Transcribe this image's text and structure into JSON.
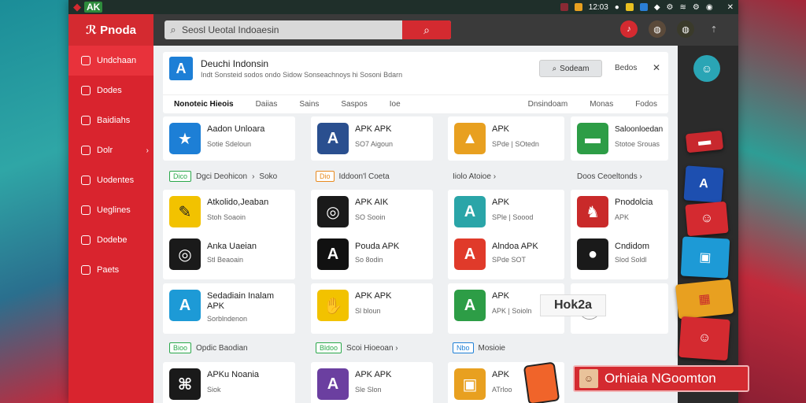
{
  "topbar": {
    "brand": "AK",
    "time": "12:03",
    "tray_colors": [
      "#d42a30",
      "#e8a020",
      "#2a7fd6",
      "#ffffff"
    ]
  },
  "header": {
    "logo": "Pnoda",
    "search_text": "Seosl Ueotal Indoaesin",
    "search_button_icon": "search-icon"
  },
  "sidebar": {
    "items": [
      {
        "label": "Undchaan",
        "icon": "home-icon"
      },
      {
        "label": "Dodes",
        "icon": "grid-icon"
      },
      {
        "label": "Baidiahs",
        "icon": "list-icon"
      },
      {
        "label": "Dolr",
        "icon": "folder-icon"
      },
      {
        "label": "Uodentes",
        "icon": "update-icon"
      },
      {
        "label": "Ueglines",
        "icon": "star-icon"
      },
      {
        "label": "Dodebe",
        "icon": "user-icon"
      },
      {
        "label": "Paets",
        "icon": "gift-icon"
      }
    ]
  },
  "apphead": {
    "icon_letter": "A",
    "title": "Deuchi Indonsin",
    "subtitle": "Indt Sonsteid sodos ondo Sidow Sonseachnoys hi Sosoni Bdarn",
    "search_box": "Sodeam",
    "extra": "Bedos",
    "tabs": [
      "Nonoteic Hieois",
      "Daiias",
      "Sains",
      "Saspos",
      "Ioe",
      "Dnsindoam",
      "Monas",
      "Fodos"
    ]
  },
  "cards": [
    {
      "name": "Aadon Unloara",
      "desc": "Sotie Sdeloun",
      "icon_color": "#1d7fd6",
      "icon_letter": "★"
    },
    {
      "name": "APK APK",
      "desc": "SO7 Aigoun",
      "icon_color": "#2a4f8f",
      "icon_letter": "A"
    },
    {
      "name": "APK",
      "desc": "SPde | SOtedn",
      "icon_color": "#e8a020",
      "icon_letter": "▲"
    },
    {
      "name": "Saloonloedan",
      "desc": "Stotoe Srouas",
      "icon_color": "#2d9d46",
      "icon_letter": "▬"
    },
    {
      "name": "Atkolido,Jeaban",
      "desc": "Stoh Soaoin",
      "icon_color": "#f2c200",
      "icon_letter": "✎"
    },
    {
      "name": "APK AIK",
      "desc": "SO Sooin",
      "icon_color": "#1a1a1a",
      "icon_letter": "◎"
    },
    {
      "name": "APK",
      "desc": "SPle | Soood",
      "icon_color": "#2aa5a8",
      "icon_letter": "A"
    },
    {
      "name": "Pnodolcia",
      "desc": "APK",
      "icon_color": "#c92a2a",
      "icon_letter": "♞"
    },
    {
      "name": "Anka Uaeian",
      "desc": "Stl Beaoain",
      "icon_color": "#1a1a1a",
      "icon_letter": "◎"
    },
    {
      "name": "Pouda APK",
      "desc": "So 8odin",
      "icon_color": "#111111",
      "icon_letter": "A"
    },
    {
      "name": "Alndoa APK",
      "desc": "SPde SOT",
      "icon_color": "#e03a2a",
      "icon_letter": "A"
    },
    {
      "name": "Cndidom",
      "desc": "Slod Soldl",
      "icon_color": "#1a1a1a",
      "icon_letter": "●"
    },
    {
      "name": "Sedadiain Inalam APK",
      "desc": "Sorblndenon",
      "icon_color": "#1d9ad6",
      "icon_letter": "A"
    },
    {
      "name": "APK APK",
      "desc": "Sl bloun",
      "icon_color": "#f2c200",
      "icon_letter": "✋"
    },
    {
      "name": "APK",
      "desc": "APK | Soioln",
      "icon_color": "#2d9d46",
      "icon_letter": "A"
    },
    {
      "name": "APKu Noania",
      "desc": "Siok",
      "icon_color": "#1a1a1a",
      "icon_letter": "⌘"
    },
    {
      "name": "APK APK",
      "desc": "Sle Slon",
      "icon_color": "#6b3fa0",
      "icon_letter": "A"
    },
    {
      "name": "APK",
      "desc": "ATrloo",
      "icon_color": "#e8a020",
      "icon_letter": "▣"
    }
  ],
  "sections": [
    {
      "tag": "Dico",
      "text": "Dgci Deohicon",
      "extra": "Soko",
      "style": "green"
    },
    {
      "tag": "Dio",
      "text": "Iddoon'l Coeta",
      "extra": "",
      "style": "orange"
    },
    {
      "text": "Iiolo Atoioe ›"
    },
    {
      "text": "Doos Ceoeltonds ›"
    },
    {
      "tag": "Bioo",
      "text": "Opdic Baodian",
      "extra": "",
      "style": "green"
    },
    {
      "tag": "Bldoo",
      "text": "Scoi Hioeoan ›",
      "extra": "",
      "style": "green"
    },
    {
      "tag": "Nbo",
      "text": "Mosioie",
      "extra": "",
      "style": "blue"
    }
  ],
  "hok": "Hok2a",
  "banner": "Orhiaia NGoomton"
}
